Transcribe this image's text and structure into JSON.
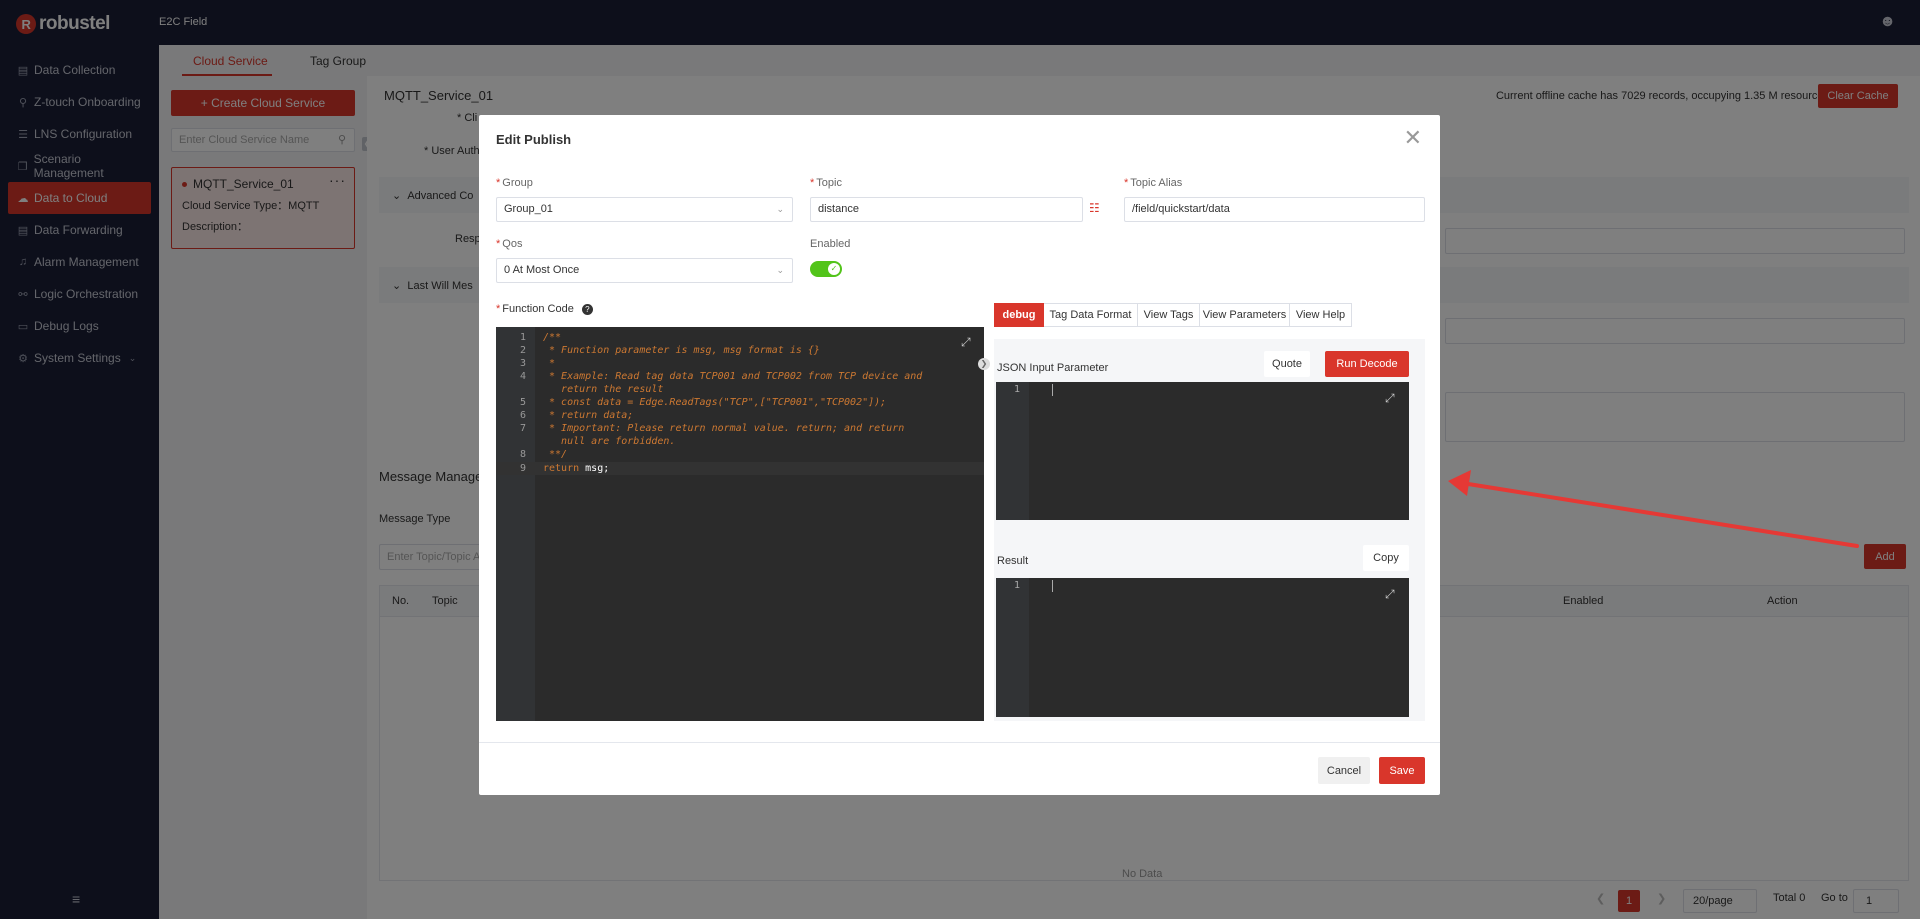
{
  "app": {
    "brand": "robustel",
    "brand_mark": "R",
    "header_title": "E2C Field"
  },
  "sidebar": {
    "items": [
      {
        "label": "Data Collection",
        "icon": "table-icon",
        "glyph": "▤"
      },
      {
        "label": "Z-touch Onboarding",
        "icon": "pin-icon",
        "glyph": "⚲"
      },
      {
        "label": "LNS Configuration",
        "icon": "list-icon",
        "glyph": "☰"
      },
      {
        "label": "Scenario Management",
        "icon": "layers-icon",
        "glyph": "❐"
      },
      {
        "label": "Data to Cloud",
        "icon": "cloud-icon",
        "glyph": "☁"
      },
      {
        "label": "Data Forwarding",
        "icon": "forward-icon",
        "glyph": "▤"
      },
      {
        "label": "Alarm Management",
        "icon": "bell-icon",
        "glyph": "♫"
      },
      {
        "label": "Logic Orchestration",
        "icon": "flow-icon",
        "glyph": "⚯"
      },
      {
        "label": "Debug Logs",
        "icon": "log-icon",
        "glyph": "▭"
      },
      {
        "label": "System Settings",
        "icon": "gear-icon",
        "glyph": "⚙",
        "chevron": "⌄"
      }
    ],
    "collapse_glyph": "≡"
  },
  "tabs": {
    "cloud_service": "Cloud Service",
    "tag_group": "Tag Group"
  },
  "left_panel": {
    "create_label": "+ Create Cloud Service",
    "search_placeholder": "Enter Cloud Service Name",
    "card": {
      "name": "MQTT_Service_01",
      "type_line": "Cloud Service Type：MQTT",
      "desc_line": "Description：",
      "more": "···"
    }
  },
  "main": {
    "title": "MQTT_Service_01",
    "cache_info": "Current offline cache has 7029 records, occupying 1.35 M resources",
    "clear_cache": "Clear Cache",
    "bg_frag_cli": "* Cli",
    "bg_frag_user_auth": "* User Auth",
    "bg_advanced": "Advanced Co",
    "bg_resp": "Resp",
    "bg_last_will": "Last Will Mes",
    "bg_message_manage": "Message Manage",
    "bg_message_type": "Message Type",
    "bg_topic_placeholder": "Enter Topic/Topic A",
    "add": "Add",
    "table": {
      "no": "No.",
      "topic": "Topic",
      "enabled": "Enabled",
      "action": "Action"
    },
    "no_data": "No Data",
    "pager": {
      "current": "1",
      "size": "20/page",
      "total": "Total 0",
      "goto": "Go to",
      "goto_value": "1"
    }
  },
  "modal": {
    "title": "Edit Publish",
    "group_label": "Group",
    "group_value": "Group_01",
    "topic_label": "Topic",
    "topic_value": "distance",
    "alias_label": "Topic Alias",
    "alias_value": "/field/quickstart/data",
    "qos_label": "Qos",
    "qos_value": "0 At Most Once",
    "enabled_label": "Enabled",
    "function_label": "Function Code",
    "code": [
      {
        "n": "1",
        "t": "/**"
      },
      {
        "n": "2",
        "t": " * Function parameter is msg, msg format is {}"
      },
      {
        "n": "3",
        "t": " *"
      },
      {
        "n": "4",
        "t": " * Example: Read tag data TCP001 and TCP002 from TCP device and"
      },
      {
        "n": "",
        "t": "   return the result"
      },
      {
        "n": "5",
        "t": " * const data = Edge.ReadTags(\"TCP\",[\"TCP001\",\"TCP002\"]);"
      },
      {
        "n": "6",
        "t": " * return data;"
      },
      {
        "n": "7",
        "t": " * Important: Please return normal value. return; and return"
      },
      {
        "n": "",
        "t": "   null are forbidden."
      },
      {
        "n": "8",
        "t": " **/"
      }
    ],
    "code_last": {
      "n": "9",
      "kw": "return ",
      "var": "msg;"
    },
    "right_tabs": [
      "debug",
      "Tag Data Format",
      "View Tags",
      "View Parameters",
      "View Help"
    ],
    "json_input_label": "JSON Input Parameter",
    "quote": "Quote",
    "run_decode": "Run Decode",
    "result_label": "Result",
    "copy": "Copy",
    "editor_line": "1",
    "cancel": "Cancel",
    "save": "Save"
  },
  "colors": {
    "accent": "#d9362b",
    "sidebar": "#1b1f36",
    "toggle_on": "#52c41a",
    "annotation_arrow": "#e53935"
  }
}
